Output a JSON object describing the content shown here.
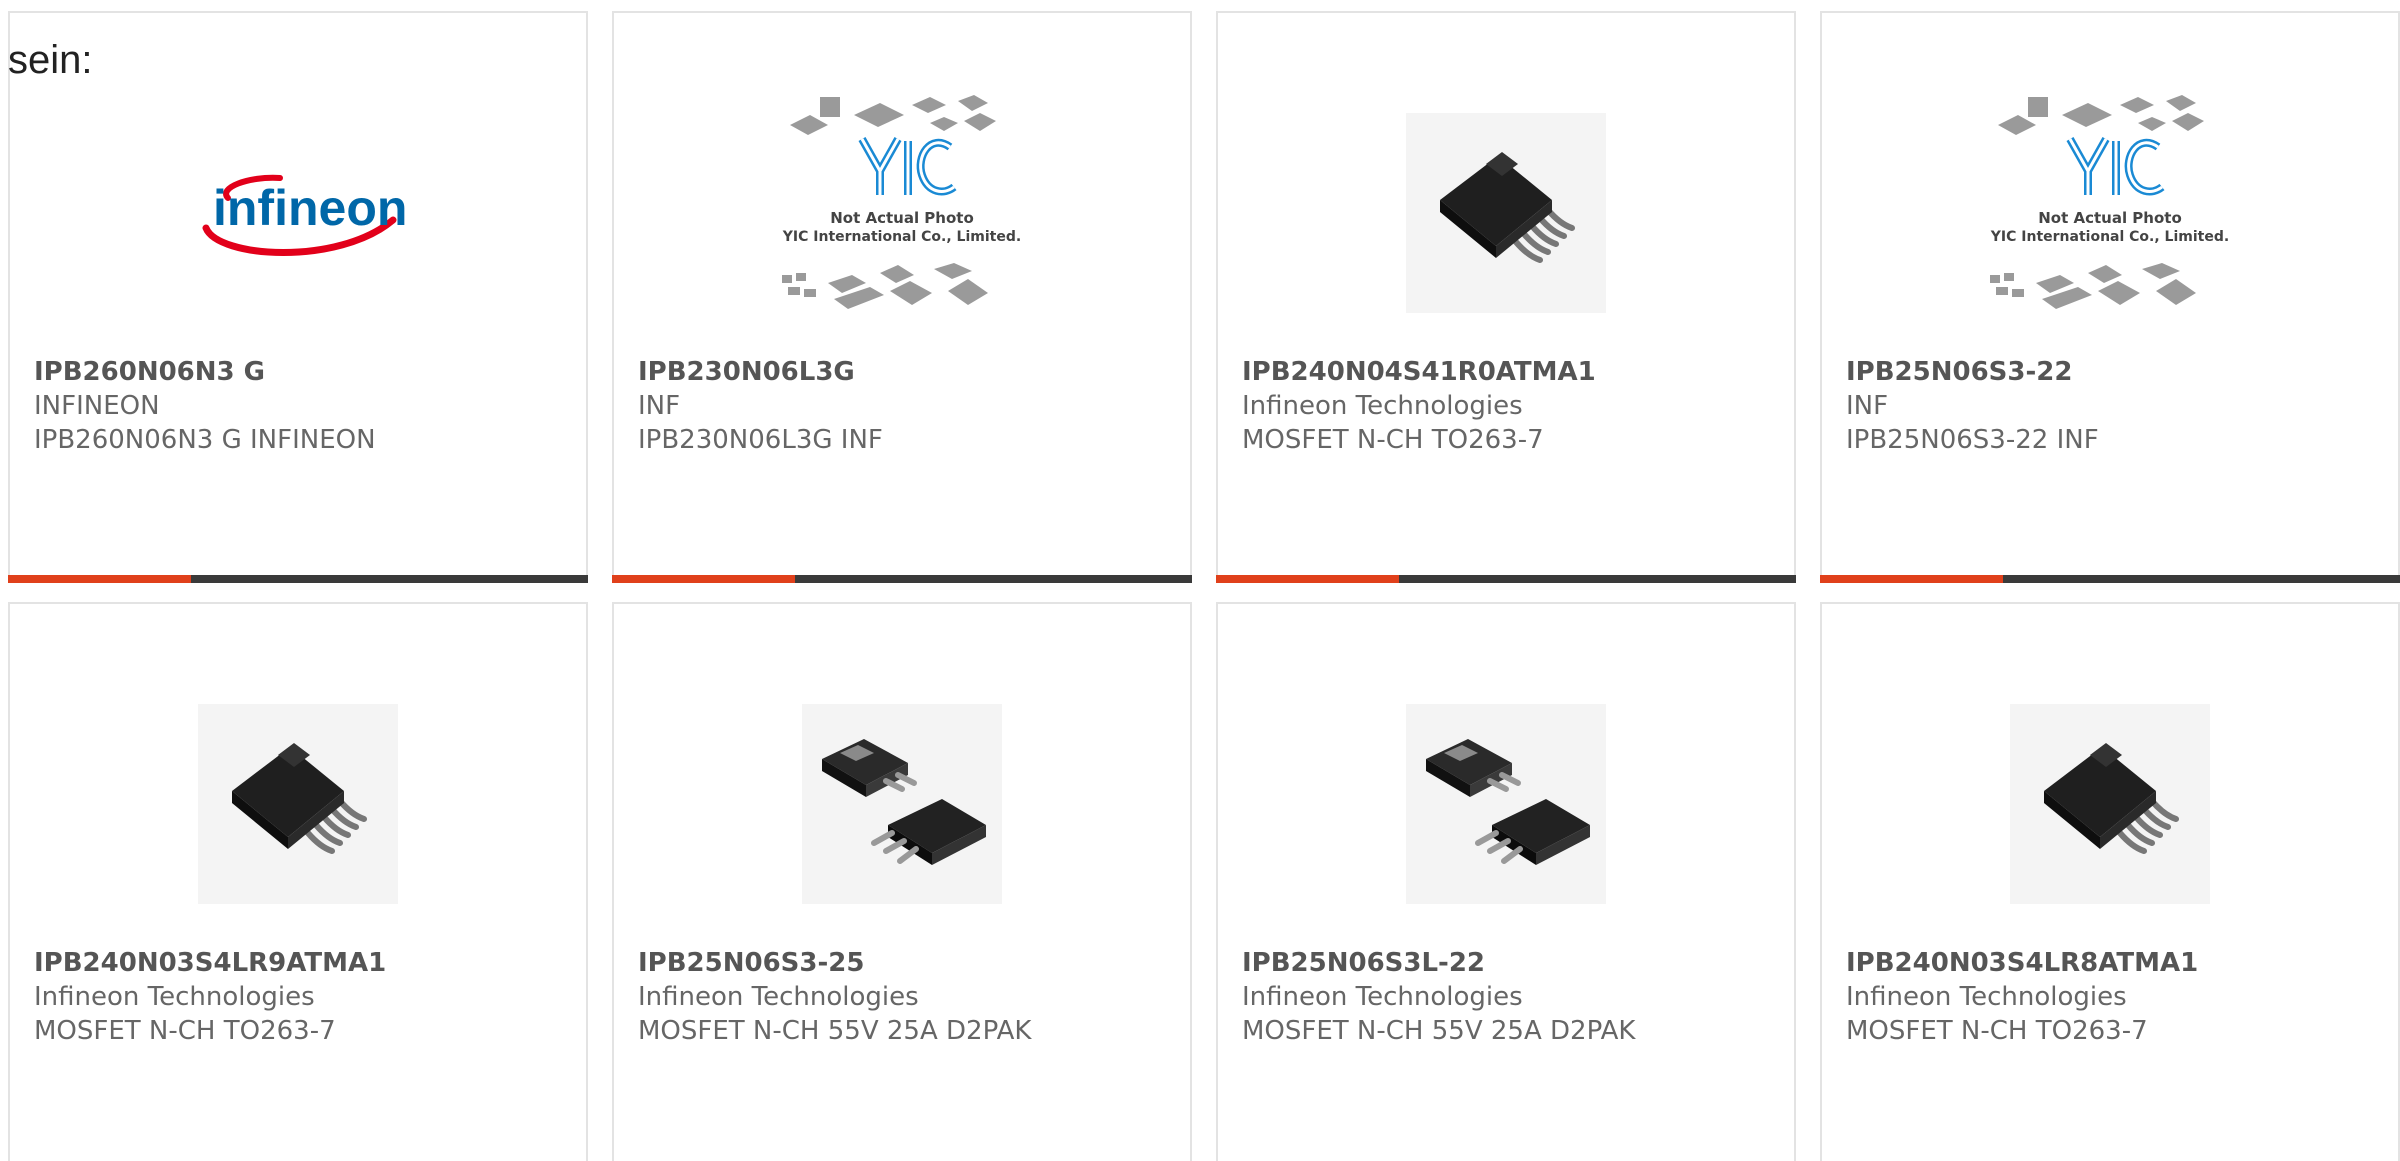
{
  "intro_text": "sein:",
  "colors": {
    "accent": "#e0401b",
    "bar_dark": "#3a3a3a",
    "border": "#e3e3e3",
    "infineon_blue": "#0067a8",
    "infineon_red": "#e2001a",
    "yic_blue": "#1a8ad4"
  },
  "cards": [
    {
      "part": "IPB260N06N3 G",
      "maker": "INFINEON",
      "desc": "IPB260N06N3 G INFINEON",
      "image": "infineon-logo",
      "logo_text": "infineon"
    },
    {
      "part": "IPB230N06L3G",
      "maker": "INF",
      "desc": "IPB230N06L3G INF",
      "image": "yic-placeholder",
      "caption_line1": "Not Actual Photo",
      "caption_line2": "YIC International Co., Limited."
    },
    {
      "part": "IPB240N04S41R0ATMA1",
      "maker": "Infineon Technologies",
      "desc": "MOSFET N-CH TO263-7",
      "image": "to263-7-package"
    },
    {
      "part": "IPB25N06S3-22",
      "maker": "INF",
      "desc": "IPB25N06S3-22 INF",
      "image": "yic-placeholder",
      "caption_line1": "Not Actual Photo",
      "caption_line2": "YIC International Co., Limited."
    },
    {
      "part": "IPB240N03S4LR9ATMA1",
      "maker": "Infineon Technologies",
      "desc": "MOSFET N-CH TO263-7",
      "image": "to263-7-package"
    },
    {
      "part": "IPB25N06S3-25",
      "maker": "Infineon Technologies",
      "desc": "MOSFET N-CH 55V 25A D2PAK",
      "image": "d2pak-package"
    },
    {
      "part": "IPB25N06S3L-22",
      "maker": "Infineon Technologies",
      "desc": "MOSFET N-CH 55V 25A D2PAK",
      "image": "d2pak-package"
    },
    {
      "part": "IPB240N03S4LR8ATMA1",
      "maker": "Infineon Technologies",
      "desc": "MOSFET N-CH TO263-7",
      "image": "to263-7-package"
    }
  ]
}
